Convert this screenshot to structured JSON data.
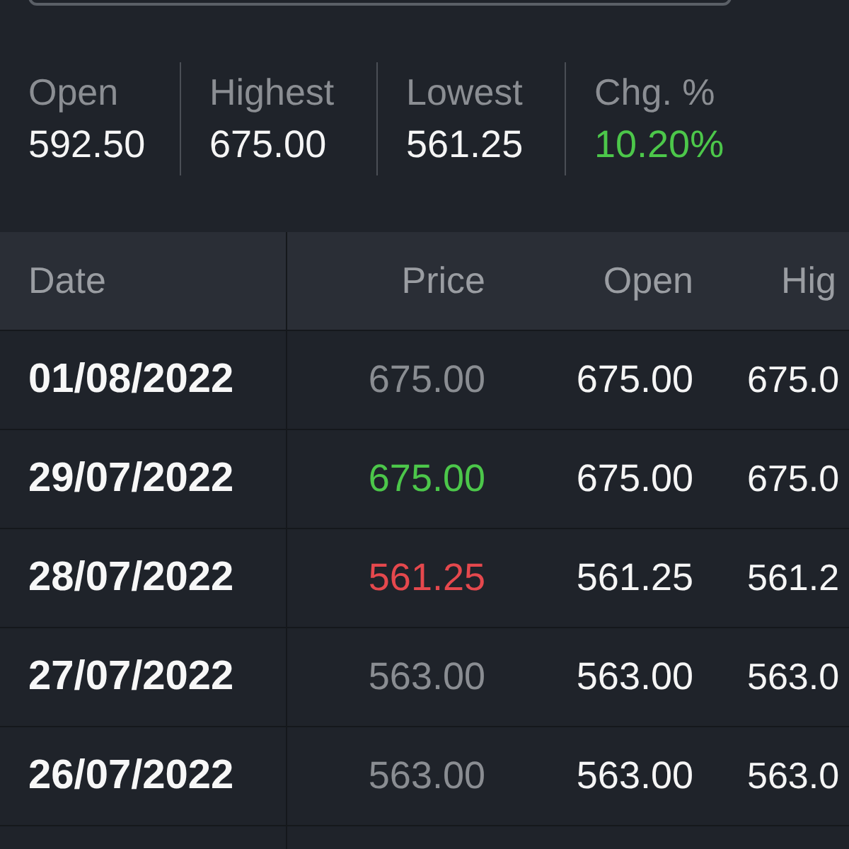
{
  "stats": [
    {
      "label": "Open",
      "value": "592.50",
      "color": "#f5f5f5"
    },
    {
      "label": "Highest",
      "value": "675.00",
      "color": "#f5f5f5"
    },
    {
      "label": "Lowest",
      "value": "561.25",
      "color": "#f5f5f5"
    },
    {
      "label": "Chg. %",
      "value": "10.20%",
      "color": "#4cc74a"
    }
  ],
  "table": {
    "columns": [
      "Date",
      "Price",
      "Open",
      "Hig"
    ],
    "rows": [
      {
        "date": "01/08/2022",
        "price": "675.00",
        "color": "#8a8d92",
        "open": "675.00",
        "column_4": "675.0"
      },
      {
        "date": "29/07/2022",
        "price": "675.00",
        "color": "#4cc74a",
        "open": "675.00",
        "column_4": "675.0"
      },
      {
        "date": "28/07/2022",
        "price": "561.25",
        "color": "#e5484d",
        "open": "561.25",
        "column_4": "561.2"
      },
      {
        "date": "27/07/2022",
        "price": "563.00",
        "color": "#8a8d92",
        "open": "563.00",
        "column_4": "563.0"
      },
      {
        "date": "26/07/2022",
        "price": "563.00",
        "color": "#8a8d92",
        "open": "563.00",
        "column_4": "563.0"
      }
    ]
  }
}
